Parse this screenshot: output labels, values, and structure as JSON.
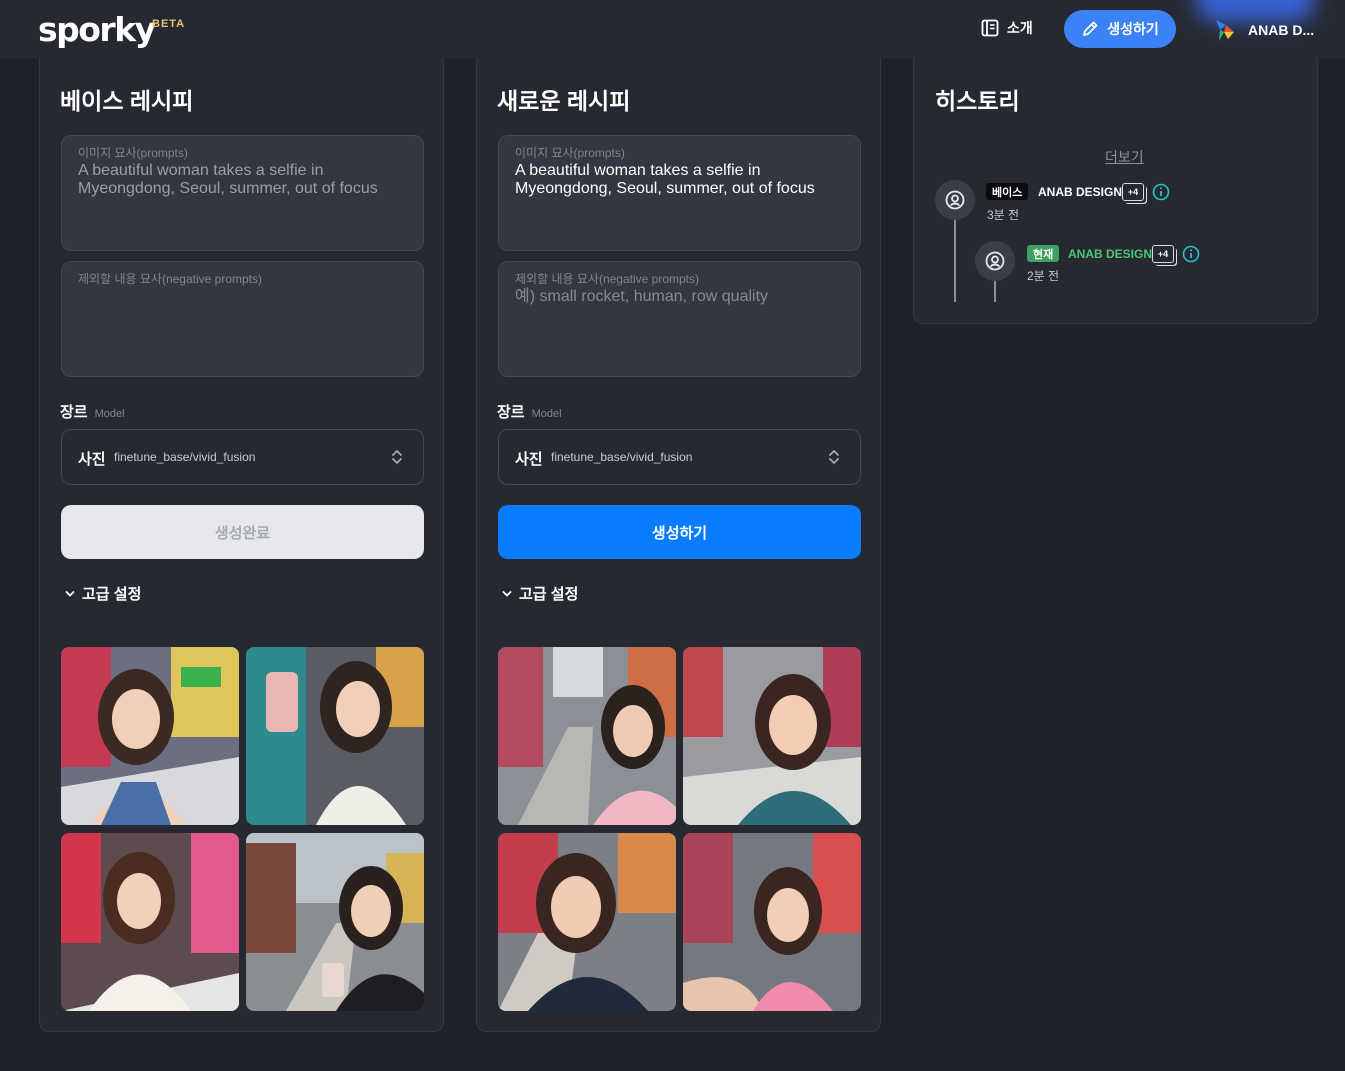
{
  "header": {
    "logo": "sporky",
    "beta": "BETA",
    "about_label": "소개",
    "create_label": "생성하기",
    "user_name": "ANAB D..."
  },
  "base_panel": {
    "title": "베이스 레시피",
    "prompt_label": "이미지 묘사(prompts)",
    "prompt_value": "A beautiful woman takes a selfie in Myeongdong, Seoul, summer, out of focus",
    "negative_label": "제외할 내용 묘사(negative prompts)",
    "negative_value": "",
    "genre_label": "장르",
    "genre_sub": "Model",
    "select_main": "사진",
    "select_sub": "finetune_base/vivid_fusion",
    "button_label": "생성완료",
    "advanced_label": "고급 설정"
  },
  "new_panel": {
    "title": "새로운 레시피",
    "prompt_label": "이미지 묘사(prompts)",
    "prompt_value": "A beautiful woman takes a selfie in Myeongdong, Seoul, summer, out of focus",
    "negative_label": "제외할 내용 묘사(negative prompts)",
    "negative_placeholder": "예) small rocket, human, row quality",
    "genre_label": "장르",
    "genre_sub": "Model",
    "select_main": "사진",
    "select_sub": "finetune_base/vivid_fusion",
    "button_label": "생성하기",
    "advanced_label": "고급 설정"
  },
  "history": {
    "title": "히스토리",
    "more_label": "더보기",
    "items": [
      {
        "tag": "베이스",
        "name": "ANAB DESIGN",
        "count": "+4",
        "time": "3분 전"
      },
      {
        "tag": "현재",
        "name": "ANAB DESIGN",
        "count": "+4",
        "time": "2분 전"
      }
    ]
  },
  "colors": {
    "accent": "#0a7cff",
    "nav_button": "#3b82f6",
    "current_tag": "#3ca25f",
    "current_name": "#4cc776",
    "info_icon": "#24c4c8"
  }
}
